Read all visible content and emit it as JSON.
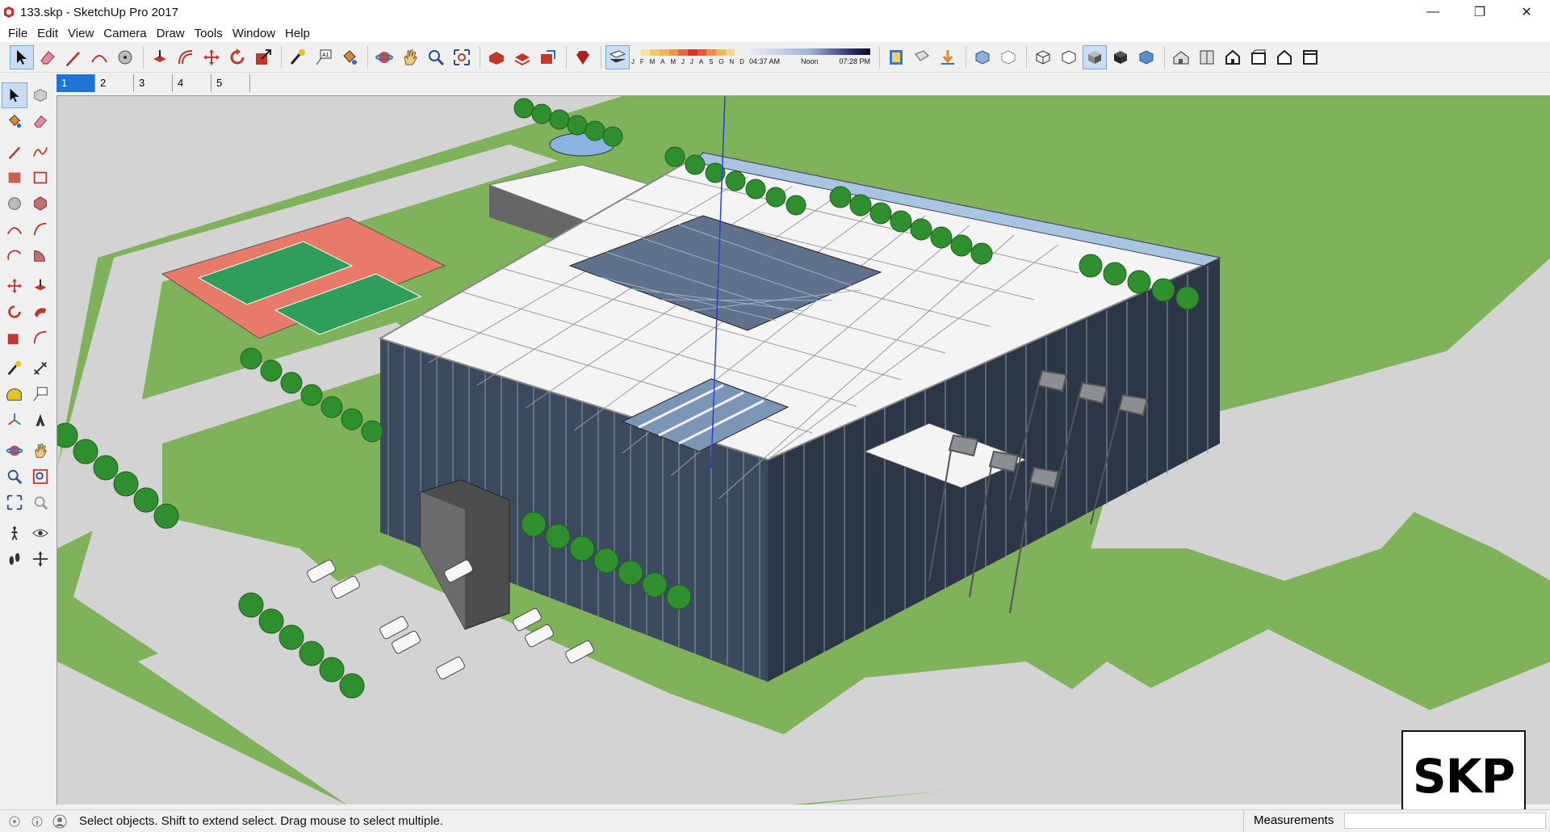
{
  "window": {
    "title": "133.skp - SketchUp Pro 2017",
    "minimize": "—",
    "maximize": "❐",
    "close": "✕"
  },
  "menu": [
    "File",
    "Edit",
    "View",
    "Camera",
    "Draw",
    "Tools",
    "Window",
    "Help"
  ],
  "shadow": {
    "months": [
      "J",
      "F",
      "M",
      "A",
      "M",
      "J",
      "J",
      "A",
      "S",
      "O",
      "N",
      "D"
    ],
    "time_start": "04:37 AM",
    "time_noon": "Noon",
    "time_end": "07:28 PM"
  },
  "scenes": [
    "1",
    "2",
    "3",
    "4",
    "5"
  ],
  "active_scene": "1",
  "status": {
    "message": "Select objects. Shift to extend select. Drag mouse to select multiple.",
    "measurements_label": "Measurements"
  },
  "logo": "SKP",
  "colors": {
    "grass": "#7fb25a",
    "pavement": "#d3d3d3",
    "roof": "#f4f4f4",
    "glass": "#3b4a5e",
    "tree": "#2f8f2f",
    "accent": "#1f74d6"
  }
}
